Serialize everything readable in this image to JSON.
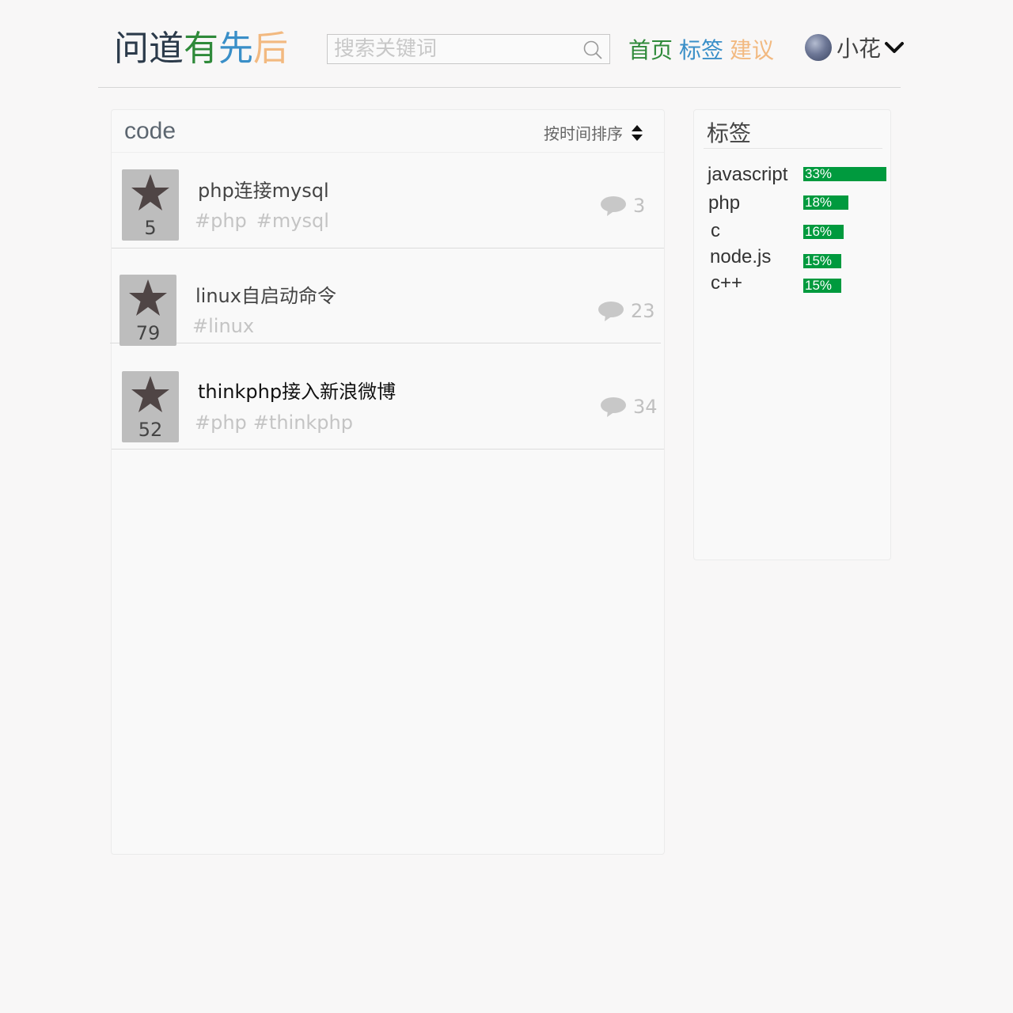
{
  "brand": {
    "chars": [
      "问",
      "道",
      "有",
      "先",
      "后"
    ],
    "colors": [
      "#2b3a4a",
      "#2b3a4a",
      "#2f8a3a",
      "#3a8fc8",
      "#f2b980"
    ]
  },
  "search": {
    "placeholder": "搜索关键词",
    "value": ""
  },
  "nav": [
    {
      "label": "首页",
      "color": "#2f8a3a"
    },
    {
      "label": "标签",
      "color": "#3a8fc8"
    },
    {
      "label": "建议",
      "color": "#f2b980"
    }
  ],
  "user": {
    "name": "小花"
  },
  "main": {
    "title": "code",
    "sort_label": "按时间排序",
    "questions": [
      {
        "votes": "5",
        "title": "php连接mysql",
        "tags": [
          "#php",
          "#mysql"
        ],
        "comments": "3"
      },
      {
        "votes": "79",
        "title": "linux自启动命令",
        "tags": [
          "#linux"
        ],
        "comments": "23"
      },
      {
        "votes": "52",
        "title": "thinkphp接入新浪微博",
        "tags": [
          "#php",
          "#thinkphp"
        ],
        "comments": "34"
      }
    ]
  },
  "tags_panel": {
    "title": "标签",
    "items": [
      {
        "name": "javascript",
        "percent_label": "33%",
        "percent": 33
      },
      {
        "name": "php",
        "percent_label": "18%",
        "percent": 18
      },
      {
        "name": "c",
        "percent_label": "16%",
        "percent": 16
      },
      {
        "name": "node.js",
        "percent_label": "15%",
        "percent": 15
      },
      {
        "name": "c++",
        "percent_label": "15%",
        "percent": 15
      }
    ]
  }
}
